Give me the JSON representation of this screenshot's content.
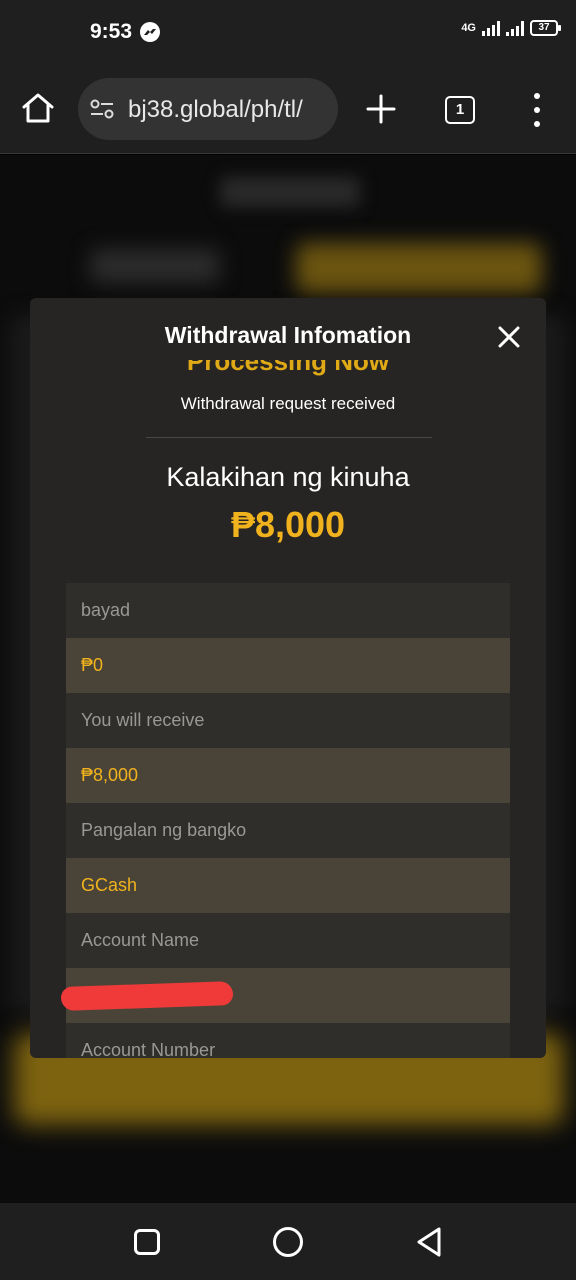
{
  "status_bar": {
    "time": "9:53",
    "network": "4G",
    "battery": "37"
  },
  "browser": {
    "url": "bj38.global/ph/tl/",
    "tab_count": "1"
  },
  "modal": {
    "title": "Withdrawal Infomation",
    "processing_text": "Processing Now",
    "status_text": "Withdrawal request received",
    "amount_label": "Kalakihan ng kinuha",
    "amount_value": "₱8,000",
    "details": [
      {
        "label": "bayad",
        "value": "₱0"
      },
      {
        "label": "You will receive",
        "value": "₱8,000"
      },
      {
        "label": "Pangalan ng bangko",
        "value": "GCash"
      },
      {
        "label": "Account Name",
        "value": ""
      },
      {
        "label": "Account Number",
        "value": ""
      }
    ]
  },
  "colors": {
    "accent_gold": "#f0b21d",
    "modal_bg": "#262523",
    "redaction": "#f03a3a"
  }
}
